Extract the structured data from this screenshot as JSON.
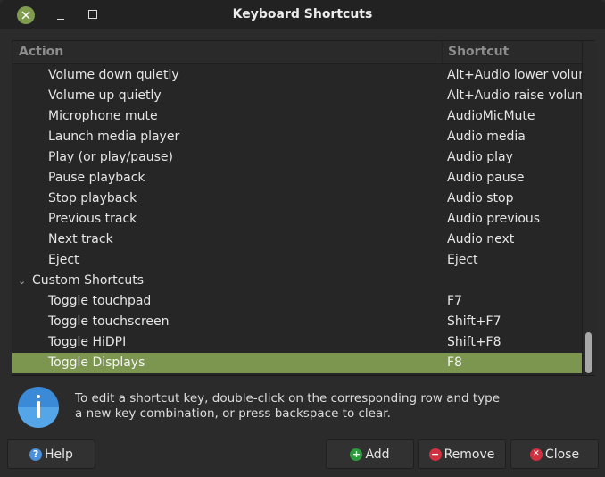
{
  "window": {
    "title": "Keyboard Shortcuts",
    "accent_color": "#7c9650"
  },
  "table": {
    "columns": {
      "action": "Action",
      "shortcut": "Shortcut"
    },
    "rows": [
      {
        "action": "Volume down quietly",
        "shortcut": "Alt+Audio lower volume",
        "type": "item"
      },
      {
        "action": "Volume up quietly",
        "shortcut": "Alt+Audio raise volume",
        "type": "item"
      },
      {
        "action": "Microphone mute",
        "shortcut": "AudioMicMute",
        "type": "item"
      },
      {
        "action": "Launch media player",
        "shortcut": "Audio media",
        "type": "item"
      },
      {
        "action": "Play (or play/pause)",
        "shortcut": "Audio play",
        "type": "item"
      },
      {
        "action": "Pause playback",
        "shortcut": "Audio pause",
        "type": "item"
      },
      {
        "action": "Stop playback",
        "shortcut": "Audio stop",
        "type": "item"
      },
      {
        "action": "Previous track",
        "shortcut": "Audio previous",
        "type": "item"
      },
      {
        "action": "Next track",
        "shortcut": "Audio next",
        "type": "item"
      },
      {
        "action": "Eject",
        "shortcut": "Eject",
        "type": "item"
      },
      {
        "action": "Custom Shortcuts",
        "shortcut": "",
        "type": "group",
        "expanded": true
      },
      {
        "action": "Toggle touchpad",
        "shortcut": "F7",
        "type": "item"
      },
      {
        "action": "Toggle touchscreen",
        "shortcut": "Shift+F7",
        "type": "item"
      },
      {
        "action": "Toggle HiDPI",
        "shortcut": "Shift+F8",
        "type": "item"
      },
      {
        "action": "Toggle Displays",
        "shortcut": "F8",
        "type": "item",
        "selected": true
      }
    ]
  },
  "info": {
    "icon": "info-icon",
    "line1": "To edit a shortcut key, double-click on the corresponding row and type",
    "line2": "a new key combination, or press backspace to clear."
  },
  "buttons": {
    "help": {
      "label": "Help",
      "icon": "help-icon"
    },
    "add": {
      "label": "Add",
      "icon": "plus-icon"
    },
    "remove": {
      "label": "Remove",
      "icon": "minus-icon"
    },
    "close": {
      "label": "Close",
      "icon": "close-icon"
    }
  }
}
